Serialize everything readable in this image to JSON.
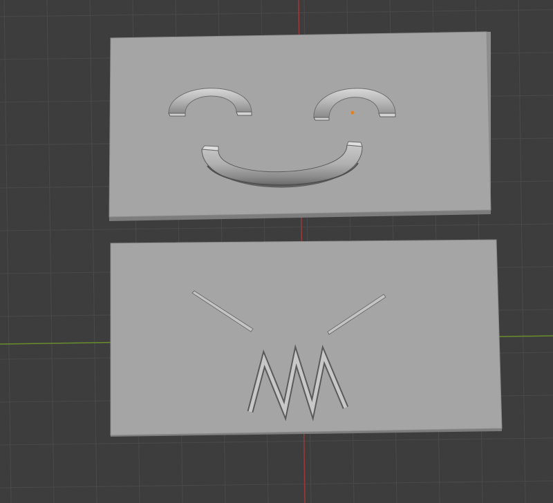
{
  "viewport": {
    "view": "3D viewport",
    "background_color": "#3d3d3d",
    "grid_color": "#4a4a4a",
    "axis_x_color": "#6a8e2e",
    "axis_y_color": "#9b3a3a",
    "origin_color": "#e8801a"
  },
  "objects": [
    {
      "name": "smiley-face-plate",
      "color": "#a5a5a5",
      "features": [
        "left-eye-arc",
        "right-eye-arc",
        "smile-arc"
      ]
    },
    {
      "name": "zigzag-face-plate",
      "color": "#a5a5a5",
      "features": [
        "left-eyebrow-line",
        "right-eyebrow-line",
        "zigzag-mouth"
      ]
    }
  ]
}
